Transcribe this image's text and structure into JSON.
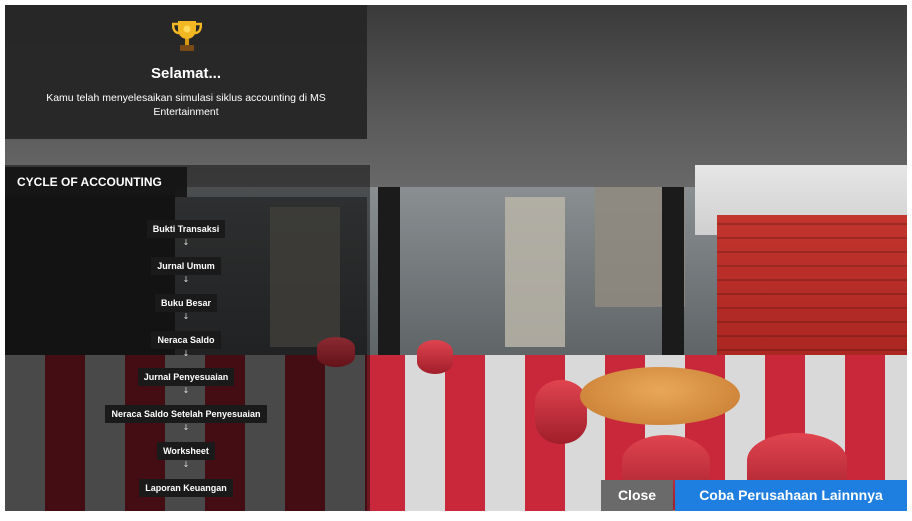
{
  "congrats": {
    "title": "Selamat...",
    "message": "Kamu telah menyelesaikan simulasi siklus accounting di MS Entertainment",
    "icon": "trophy-icon"
  },
  "cycle": {
    "title": "CYCLE OF ACCOUNTING",
    "arrow": "↓",
    "steps": [
      "Bukti Transaksi",
      "Jurnal Umum",
      "Buku Besar",
      "Neraca Saldo",
      "Jurnal Penyesuaian",
      "Neraca Saldo Setelah Penyesuaian",
      "Worksheet",
      "Laporan Keuangan"
    ]
  },
  "buttons": {
    "close": "Close",
    "try_other": "Coba Perusahaan Lainnnya"
  },
  "colors": {
    "panel": "#262626",
    "accent_blue": "#1f7fe0",
    "close_gray": "#6a6a6a",
    "brick_red": "#c3342e"
  }
}
